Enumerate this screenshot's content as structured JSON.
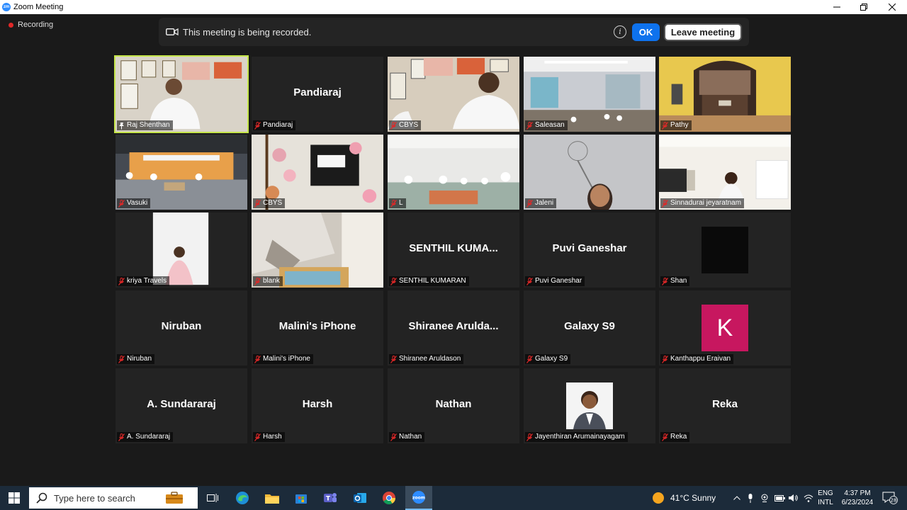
{
  "window": {
    "title": "Zoom Meeting"
  },
  "recording": {
    "label": "Recording"
  },
  "banner": {
    "message": "This meeting is being recorded.",
    "ok_label": "OK",
    "leave_label": "Leave meeting"
  },
  "participants": [
    {
      "big_name": "",
      "label": "Raj Shenthan",
      "video": true
    },
    {
      "big_name": "Pandiaraj",
      "label": "Pandiaraj",
      "video": false
    },
    {
      "big_name": "",
      "label": "CBYS",
      "video": true
    },
    {
      "big_name": "",
      "label": "Saleasan",
      "video": true
    },
    {
      "big_name": "",
      "label": "Pathy",
      "video": true
    },
    {
      "big_name": "",
      "label": "Vasuki",
      "video": true
    },
    {
      "big_name": "",
      "label": "CBYS",
      "video": true
    },
    {
      "big_name": "",
      "label": "L",
      "video": true
    },
    {
      "big_name": "",
      "label": "Jaleni",
      "video": true
    },
    {
      "big_name": "",
      "label": "Sinnadurai jeyaratnam",
      "video": true
    },
    {
      "big_name": "",
      "label": "kriya Travels",
      "video": true
    },
    {
      "big_name": "",
      "label": "blank",
      "video": true
    },
    {
      "big_name": "SENTHIL  KUMA...",
      "label": "SENTHIL KUMARAN",
      "video": false
    },
    {
      "big_name": "Puvi Ganeshar",
      "label": "Puvi Ganeshar",
      "video": false
    },
    {
      "big_name": "",
      "label": "Shan",
      "video": false
    },
    {
      "big_name": "Niruban",
      "label": "Niruban",
      "video": false
    },
    {
      "big_name": "Malini's iPhone",
      "label": "Malini's iPhone",
      "video": false
    },
    {
      "big_name": "Shiranee  Arulda...",
      "label": "Shiranee Aruldason",
      "video": false
    },
    {
      "big_name": "Galaxy S9",
      "label": "Galaxy S9",
      "video": false
    },
    {
      "big_name": "",
      "label": "Kanthappu Eraivan",
      "avatar_letter": "K",
      "avatar_color": "#c7175f",
      "video": false
    },
    {
      "big_name": "A. Sundararaj",
      "label": "A. Sundararaj",
      "video": false
    },
    {
      "big_name": "Harsh",
      "label": "Harsh",
      "video": false
    },
    {
      "big_name": "Nathan",
      "label": "Nathan",
      "video": false
    },
    {
      "big_name": "",
      "label": "Jayenthiran Arumainayagam",
      "video": false
    },
    {
      "big_name": "Reka",
      "label": "Reka",
      "video": false
    }
  ],
  "taskbar": {
    "search_placeholder": "Type here to search",
    "weather": "41°C  Sunny",
    "lang_top": "ENG",
    "lang_bottom": "INTL",
    "time": "4:37 PM",
    "date": "6/23/2024",
    "notification_count": "28"
  },
  "colors": {
    "accent": "#0e72ed",
    "active_speaker": "#c5e54a",
    "mute": "#e02828"
  }
}
